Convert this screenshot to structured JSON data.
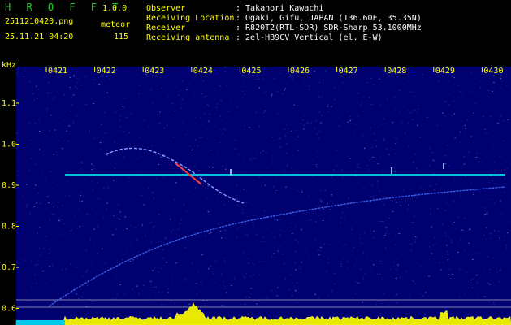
{
  "app": {
    "logo": "H R O F F T",
    "version": "1.0.0"
  },
  "file": {
    "name": "2511210420.png",
    "datetime": "25.11.21 04:20"
  },
  "meteor": {
    "label": "meteor",
    "count": "115"
  },
  "info": [
    {
      "label": "Observer",
      "value": ": Takanori Kawachi"
    },
    {
      "label": "Receiving Location",
      "value": ": Ogaki, Gifu, JAPAN (136.60E, 35.35N)"
    },
    {
      "label": "Receiver",
      "value": ": R820T2(RTL-SDR) SDR-Sharp 53.1000MHz"
    },
    {
      "label": "Receiving antenna",
      "value": ": 2el-HB9CV Vertical (el. E-W)"
    }
  ],
  "spectrogram": {
    "y_unit": "kHz",
    "x_ticks": [
      "0421",
      "0422",
      "0423",
      "0424",
      "0425",
      "0426",
      "0427",
      "0428",
      "0429",
      "0430"
    ],
    "y_ticks": [
      "1.1",
      "1.0",
      "0.9",
      "0.8",
      "0.7",
      "0.6"
    ],
    "colors": {
      "axis_text": "#ffff00",
      "background": "#000070",
      "beacon": "#00ffff",
      "echo": "#ff4040"
    }
  }
}
